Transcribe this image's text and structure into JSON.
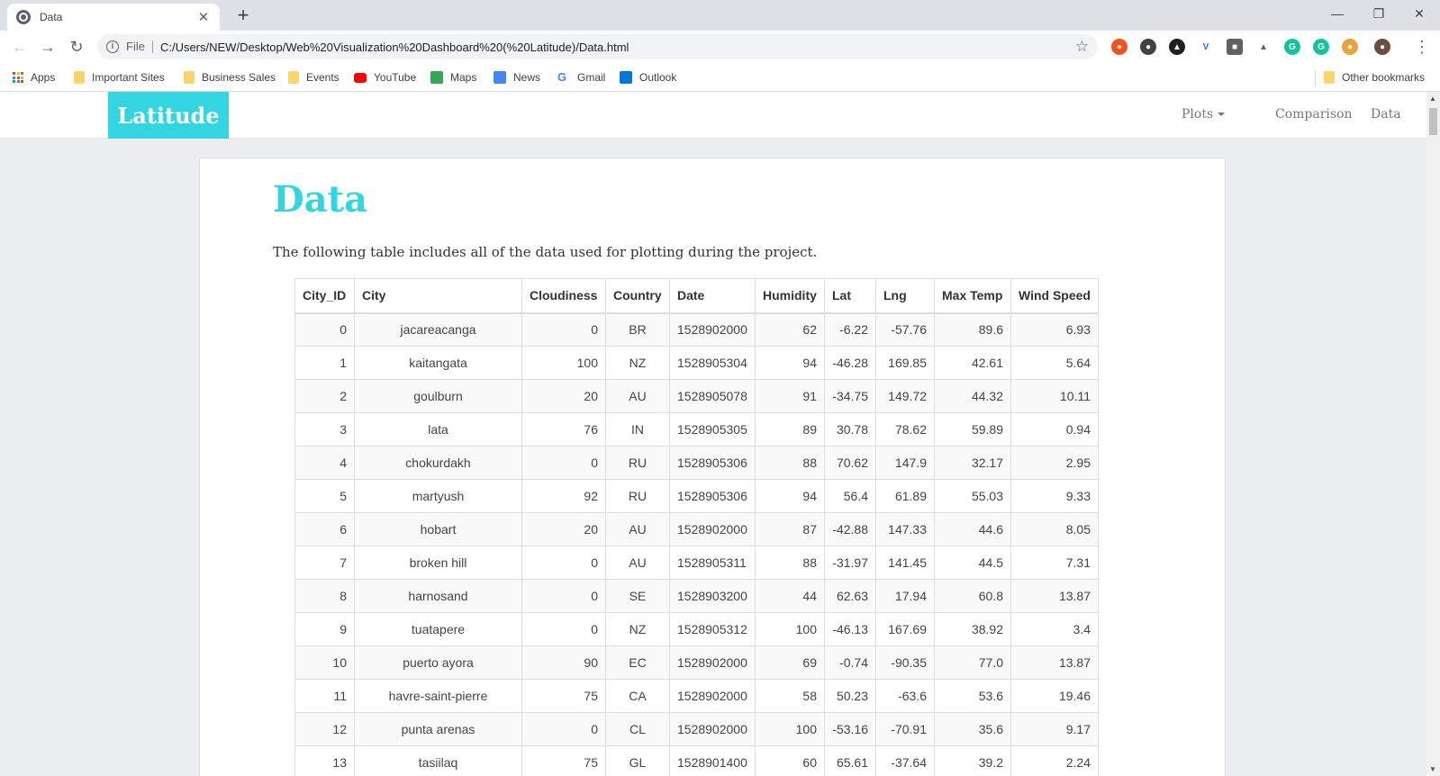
{
  "browser": {
    "tab_title": "Data",
    "new_tab": "+",
    "url_scheme": "File",
    "url": "C:/Users/NEW/Desktop/Web%20Visualization%20Dashboard%20(%20Latitude)/Data.html",
    "bookmarks": [
      "Apps",
      "Important Sites",
      "Business Sales",
      "Events",
      "YouTube",
      "Maps",
      "News",
      "Gmail",
      "Outlook"
    ],
    "other_bookmarks": "Other bookmarks"
  },
  "navbar": {
    "brand": "Latitude",
    "plots": "Plots",
    "comparison": "Comparison",
    "data": "Data"
  },
  "page": {
    "title": "Data",
    "description": "The following table includes all of the data used for plotting during the project."
  },
  "table": {
    "headers": [
      "City_ID",
      "City",
      "Cloudiness",
      "Country",
      "Date",
      "Humidity",
      "Lat",
      "Lng",
      "Max Temp",
      "Wind Speed"
    ],
    "rows": [
      [
        "0",
        "jacareacanga",
        "0",
        "BR",
        "1528902000",
        "62",
        "-6.22",
        "-57.76",
        "89.6",
        "6.93"
      ],
      [
        "1",
        "kaitangata",
        "100",
        "NZ",
        "1528905304",
        "94",
        "-46.28",
        "169.85",
        "42.61",
        "5.64"
      ],
      [
        "2",
        "goulburn",
        "20",
        "AU",
        "1528905078",
        "91",
        "-34.75",
        "149.72",
        "44.32",
        "10.11"
      ],
      [
        "3",
        "lata",
        "76",
        "IN",
        "1528905305",
        "89",
        "30.78",
        "78.62",
        "59.89",
        "0.94"
      ],
      [
        "4",
        "chokurdakh",
        "0",
        "RU",
        "1528905306",
        "88",
        "70.62",
        "147.9",
        "32.17",
        "2.95"
      ],
      [
        "5",
        "martyush",
        "92",
        "RU",
        "1528905306",
        "94",
        "56.4",
        "61.89",
        "55.03",
        "9.33"
      ],
      [
        "6",
        "hobart",
        "20",
        "AU",
        "1528902000",
        "87",
        "-42.88",
        "147.33",
        "44.6",
        "8.05"
      ],
      [
        "7",
        "broken hill",
        "0",
        "AU",
        "1528905311",
        "88",
        "-31.97",
        "141.45",
        "44.5",
        "7.31"
      ],
      [
        "8",
        "harnosand",
        "0",
        "SE",
        "1528903200",
        "44",
        "62.63",
        "17.94",
        "60.8",
        "13.87"
      ],
      [
        "9",
        "tuatapere",
        "0",
        "NZ",
        "1528905312",
        "100",
        "-46.13",
        "167.69",
        "38.92",
        "3.4"
      ],
      [
        "10",
        "puerto ayora",
        "90",
        "EC",
        "1528902000",
        "69",
        "-0.74",
        "-90.35",
        "77.0",
        "13.87"
      ],
      [
        "11",
        "havre-saint-pierre",
        "75",
        "CA",
        "1528902000",
        "58",
        "50.23",
        "-63.6",
        "53.6",
        "19.46"
      ],
      [
        "12",
        "punta arenas",
        "0",
        "CL",
        "1528902000",
        "100",
        "-53.16",
        "-70.91",
        "35.6",
        "9.17"
      ],
      [
        "13",
        "tasiilaq",
        "75",
        "GL",
        "1528901400",
        "60",
        "65.61",
        "-37.64",
        "39.2",
        "2.24"
      ]
    ]
  },
  "colors": {
    "accent": "#33d5e1"
  }
}
